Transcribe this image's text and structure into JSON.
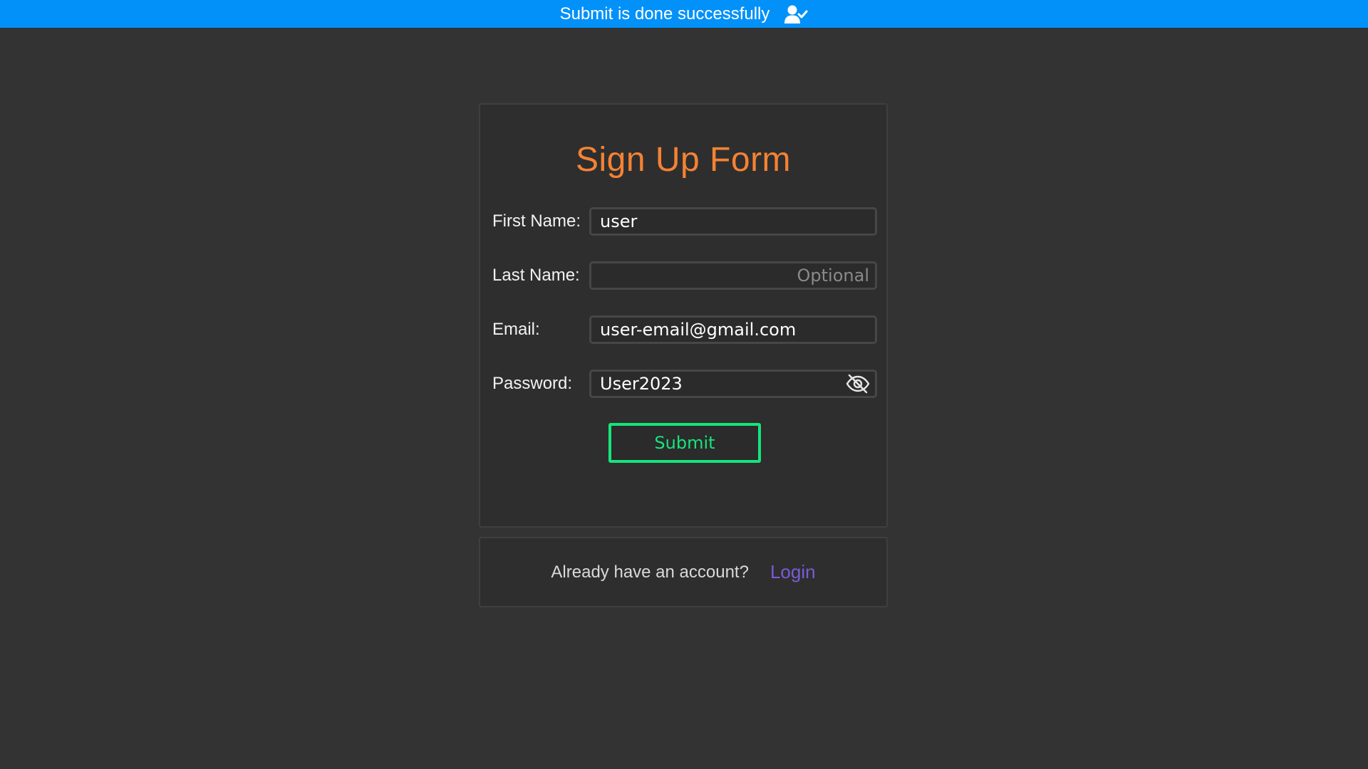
{
  "banner": {
    "message": "Submit is done successfully",
    "icon": "user-check-icon",
    "bg_color": "#0291f8"
  },
  "form": {
    "title": "Sign Up Form",
    "title_color": "#f58233",
    "fields": {
      "first_name": {
        "label": "First Name:",
        "value": "user",
        "placeholder": ""
      },
      "last_name": {
        "label": "Last Name:",
        "value": "",
        "placeholder": "Optional"
      },
      "email": {
        "label": "Email:",
        "value": "user-email@gmail.com",
        "placeholder": ""
      },
      "password": {
        "label": "Password:",
        "value": "User2023",
        "placeholder": "",
        "toggle_icon": "eye-off-icon"
      }
    },
    "submit_label": "Submit",
    "submit_color": "#16e47c"
  },
  "footer": {
    "prompt": "Already have an account?",
    "link_label": "Login",
    "link_color": "#7b5bd6"
  }
}
